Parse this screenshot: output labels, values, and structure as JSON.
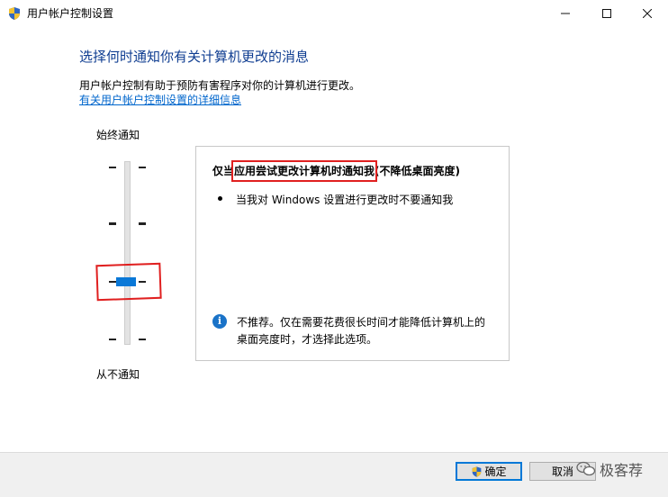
{
  "window": {
    "title": "用户帐户控制设置",
    "controls": {
      "minimize": "—",
      "maximize": "☐",
      "close": "✕"
    }
  },
  "main": {
    "heading": "选择何时通知你有关计算机更改的消息",
    "description": "用户帐户控制有助于预防有害程序对你的计算机进行更改。",
    "more_link": "有关用户帐户控制设置的详细信息"
  },
  "slider": {
    "label_top": "始终通知",
    "label_bottom": "从不通知",
    "levels": 4,
    "selected_level": 3
  },
  "panel": {
    "title": "仅当应用尝试更改计算机时通知我(不降低桌面亮度)",
    "bullet": "当我对 Windows 设置进行更改时不要通知我",
    "note_line1": "不推荐。仅在需要花费很长时间才能降低计算机上的",
    "note_line2": "桌面亮度时，才选择此选项。"
  },
  "footer": {
    "ok_label": "确定",
    "cancel_label": "取消"
  },
  "watermark": {
    "text": "极客荐"
  },
  "colors": {
    "heading": "#0f3d91",
    "link": "#0066cc",
    "thumb": "#0a78d7",
    "highlight": "#e02020"
  }
}
